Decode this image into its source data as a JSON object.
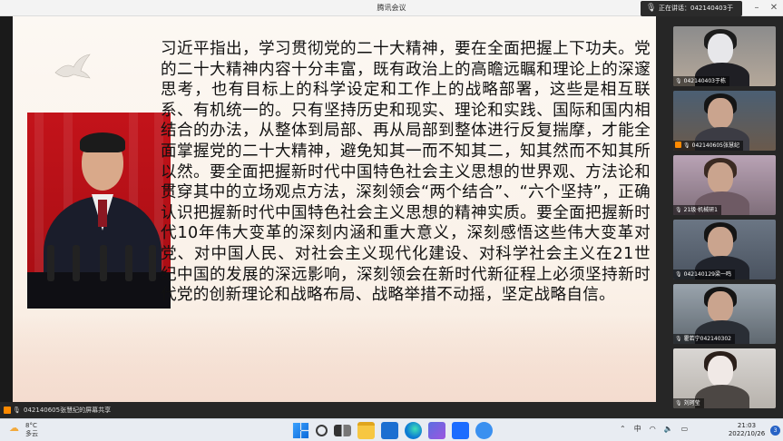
{
  "window": {
    "title": "腾讯会议",
    "speaking_label": "正在讲话：042140403于栋..."
  },
  "slide": {
    "paragraph": "习近平指出，学习贯彻党的二十大精神，要在全面把握上下功夫。党的二十大精神内容十分丰富，既有政治上的高瞻远瞩和理论上的深邃思考，也有目标上的科学设定和工作上的战略部署，这些是相互联系、有机统一的。只有坚持历史和现实、理论和实践、国际和国内相结合的办法，从整体到局部、再从局部到整体进行反复揣摩，才能全面掌握党的二十大精神，避免知其一而不知其二，知其然而不知其所以然。要全面把握新时代中国特色社会主义思想的世界观、方法论和贯穿其中的立场观点方法，深刻领会“两个结合”、“六个坚持”，正确认识把握新时代中国特色社会主义思想的精神实质。要全面把握新时代10年伟大变革的深刻内涵和重大意义，深刻感悟这些伟大变革对党、对中国人民、对社会主义现代化建设、对科学社会主义在21世纪中国的发展的深远影响，深刻领会在新时代新征程上必须坚持新时代党的创新理论和战略布局、战略举措不动摇，坚定战略自信。"
  },
  "participants": [
    {
      "label": "042140403于栋",
      "icon": "mic-icon"
    },
    {
      "label": "042140605张慧纪",
      "icon": "mic-icon"
    },
    {
      "label": "21级·机械研1",
      "icon": "mic-icon"
    },
    {
      "label": "042140129梁一鸣",
      "icon": "mic-icon"
    },
    {
      "label": "霍若宁042140302",
      "icon": "mic-icon"
    },
    {
      "label": "刘珂莹",
      "icon": "mic-icon"
    }
  ],
  "statusbar": {
    "text": "042140605张慧纪的屏幕共享"
  },
  "taskbar": {
    "weather_temp": "8°C",
    "weather_desc": "多云",
    "ime_label": "中",
    "time": "21:03",
    "date": "2022/10/26",
    "notifications": "3"
  },
  "colors": {
    "accent": "#2762c5",
    "meeting_orange": "#ff8a00",
    "slide_red": "#c3131a"
  }
}
